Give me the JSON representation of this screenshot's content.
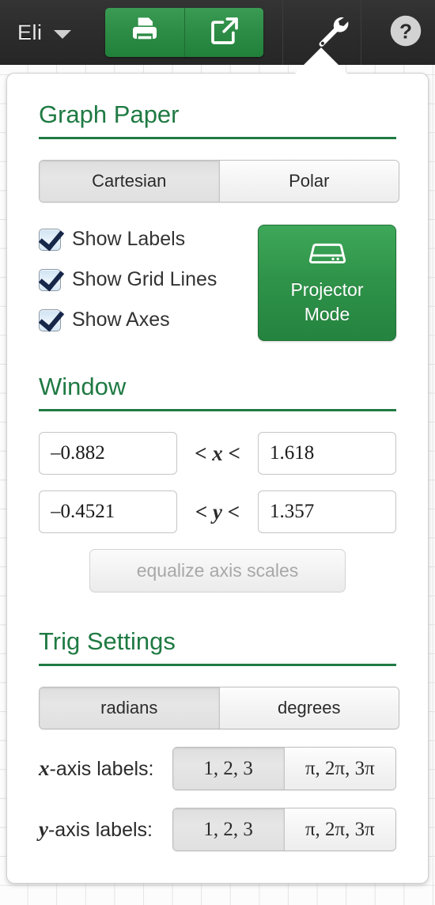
{
  "topbar": {
    "user_name": "Eli",
    "user_caret_icon": "chevron-down-icon",
    "print_icon": "printer-icon",
    "share_icon": "share-export-icon",
    "wrench_icon": "wrench-icon",
    "help_icon": "question-circle-icon",
    "background_color": "#2c2c2c",
    "green_button_color": "#2d8c46"
  },
  "panel": {
    "accent_color": "#1f7a43",
    "graph_paper": {
      "title": "Graph Paper",
      "coord_system": {
        "options": [
          "Cartesian",
          "Polar"
        ],
        "selected": "Cartesian"
      },
      "checkboxes": [
        {
          "label": "Show Labels",
          "checked": true
        },
        {
          "label": "Show Grid Lines",
          "checked": true
        },
        {
          "label": "Show Axes",
          "checked": true
        }
      ],
      "projector": {
        "line1": "Projector",
        "line2": "Mode",
        "icon": "projector-icon",
        "color": "#2f9449"
      }
    },
    "window": {
      "title": "Window",
      "x_min": "–0.882",
      "x_max": "1.618",
      "x_relation_left": "<",
      "x_variable": "x",
      "x_relation_right": "<",
      "y_min": "–0.4521",
      "y_max": "1.357",
      "y_relation_left": "<",
      "y_variable": "y",
      "y_relation_right": "<",
      "equalize_label": "equalize axis scales",
      "equalize_enabled": false
    },
    "trig": {
      "title": "Trig Settings",
      "angle_mode": {
        "options": [
          "radians",
          "degrees"
        ],
        "selected": "radians"
      },
      "x_axis_labels": {
        "label": "-axis labels:",
        "variable": "x",
        "options": [
          "1, 2, 3",
          "π, 2π, 3π"
        ],
        "selected": "1, 2, 3"
      },
      "y_axis_labels": {
        "label": "-axis labels:",
        "variable": "y",
        "options": [
          "1, 2, 3",
          "π, 2π, 3π"
        ],
        "selected": "1, 2, 3"
      }
    }
  }
}
